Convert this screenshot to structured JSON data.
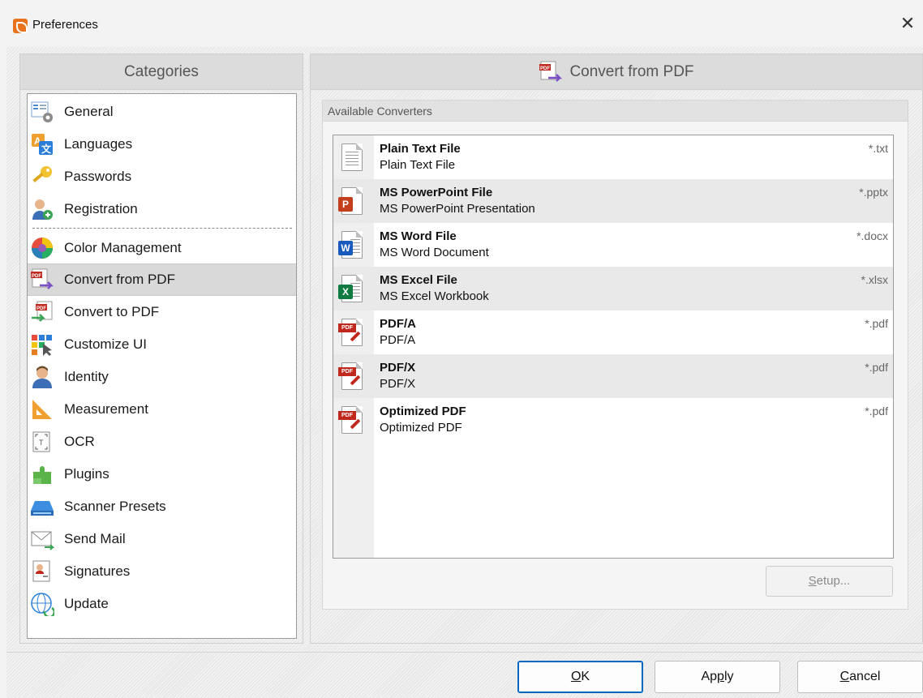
{
  "window": {
    "title": "Preferences",
    "close_glyph": "✕"
  },
  "categories": {
    "header": "Categories",
    "items": [
      {
        "label": "General",
        "icon": "general-settings-icon"
      },
      {
        "label": "Languages",
        "icon": "languages-icon"
      },
      {
        "label": "Passwords",
        "icon": "key-icon"
      },
      {
        "label": "Registration",
        "icon": "user-add-icon"
      },
      {
        "label": "Color Management",
        "icon": "color-wheel-icon"
      },
      {
        "label": "Convert from PDF",
        "icon": "convert-from-pdf-icon",
        "selected": true
      },
      {
        "label": "Convert to PDF",
        "icon": "convert-to-pdf-icon"
      },
      {
        "label": "Customize UI",
        "icon": "customize-ui-icon"
      },
      {
        "label": "Identity",
        "icon": "identity-icon"
      },
      {
        "label": "Measurement",
        "icon": "ruler-triangle-icon"
      },
      {
        "label": "OCR",
        "icon": "ocr-icon"
      },
      {
        "label": "Plugins",
        "icon": "puzzle-icon"
      },
      {
        "label": "Scanner Presets",
        "icon": "scanner-icon"
      },
      {
        "label": "Send Mail",
        "icon": "mail-icon"
      },
      {
        "label": "Signatures",
        "icon": "certificate-icon"
      },
      {
        "label": "Update",
        "icon": "globe-update-icon"
      }
    ]
  },
  "content": {
    "header": "Convert from PDF",
    "group_title": "Available Converters",
    "converters": [
      {
        "title": "Plain Text File",
        "subtitle": "Plain Text File",
        "ext": "*.txt",
        "icon": "text-file-icon"
      },
      {
        "title": "MS PowerPoint File",
        "subtitle": "MS PowerPoint Presentation",
        "ext": "*.pptx",
        "icon": "powerpoint-icon"
      },
      {
        "title": "MS Word File",
        "subtitle": "MS Word Document",
        "ext": "*.docx",
        "icon": "word-icon"
      },
      {
        "title": "MS Excel File",
        "subtitle": "MS Excel Workbook",
        "ext": "*.xlsx",
        "icon": "excel-icon"
      },
      {
        "title": "PDF/A",
        "subtitle": "PDF/A",
        "ext": "*.pdf",
        "icon": "pdf-file-icon"
      },
      {
        "title": "PDF/X",
        "subtitle": "PDF/X",
        "ext": "*.pdf",
        "icon": "pdf-file-icon"
      },
      {
        "title": "Optimized PDF",
        "subtitle": "Optimized PDF",
        "ext": "*.pdf",
        "icon": "pdf-file-icon"
      }
    ],
    "setup_button": {
      "mnemonic": "S",
      "rest": "etup..."
    }
  },
  "buttons": {
    "ok": {
      "mnemonic": "O",
      "rest": "K"
    },
    "apply": {
      "pre": "Ap",
      "mnemonic": "p",
      "rest": "ly"
    },
    "cancel": {
      "mnemonic": "C",
      "rest": "ancel"
    }
  },
  "colors": {
    "accent": "#0067c0",
    "pdf_red": "#c0281e",
    "powerpoint": "#c43e1c",
    "word": "#185abd",
    "excel": "#107c41"
  }
}
